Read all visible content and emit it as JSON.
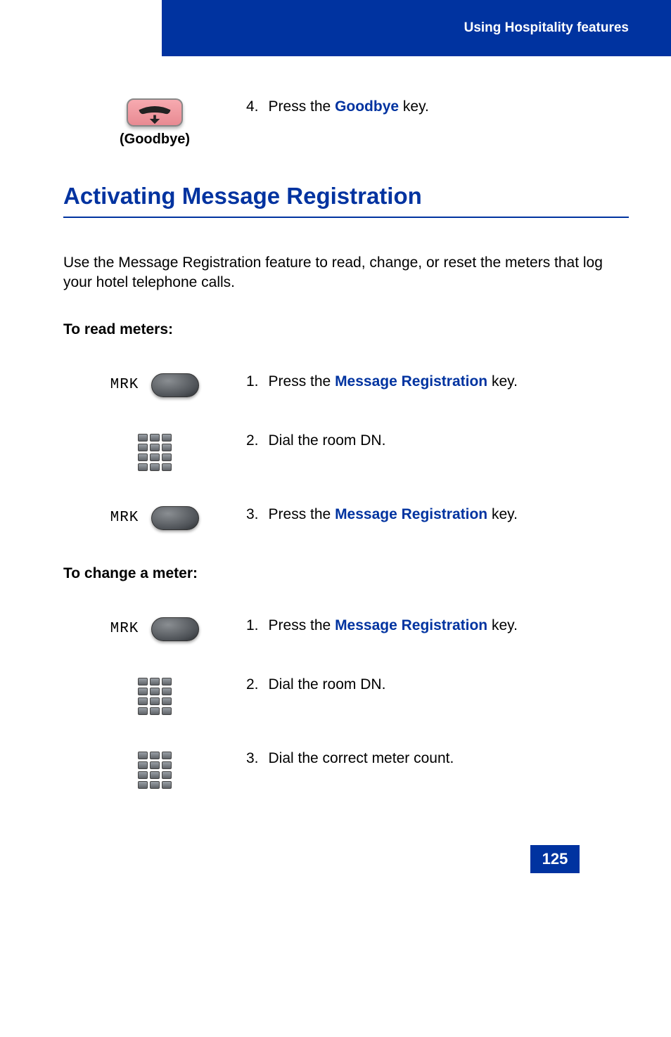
{
  "header": {
    "title": "Using Hospitality features"
  },
  "goodbye_step": {
    "num": "4.",
    "pre": "Press the ",
    "term": "Goodbye",
    "post": " key.",
    "label": "(Goodbye)"
  },
  "section": {
    "heading": "Activating Message Registration",
    "intro": "Use the Message Registration feature to read, change, or reset the meters that log your hotel telephone calls."
  },
  "mrk_label": "MRK",
  "read_meters": {
    "heading": "To read meters:",
    "steps": [
      {
        "num": "1.",
        "pre": "Press the ",
        "term": "Message Registration",
        "post": " key."
      },
      {
        "num": "2.",
        "text": "Dial the room DN."
      },
      {
        "num": "3.",
        "pre": "Press the ",
        "term": "Message Registration",
        "post": " key."
      }
    ]
  },
  "change_meter": {
    "heading": "To change a meter:",
    "steps": [
      {
        "num": "1.",
        "pre": "Press the ",
        "term": "Message Registration",
        "post": " key."
      },
      {
        "num": "2.",
        "text": "Dial the room DN."
      },
      {
        "num": "3.",
        "text": "Dial the correct meter count."
      }
    ]
  },
  "page_number": "125"
}
